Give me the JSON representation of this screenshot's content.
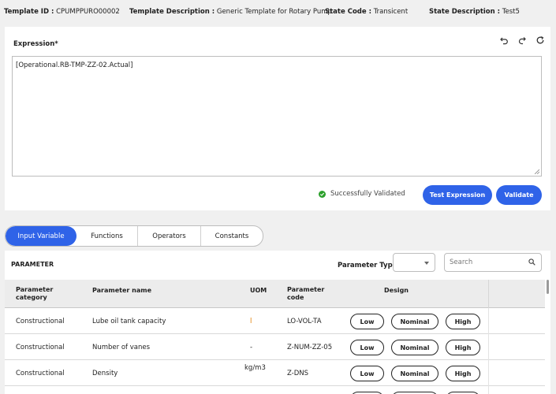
{
  "header": {
    "template_id_label": "Template ID :",
    "template_id": "CPUMPPURO00002",
    "template_desc_label": "Template Description :",
    "template_desc": "Generic Template for Rotary Pump",
    "state_code_label": "State Code :",
    "state_code": "Transicent",
    "state_desc_label": "State Description :",
    "state_desc": "Test5"
  },
  "expression": {
    "title": "Expression*",
    "value": "[Operational.RB-TMP-ZZ-02.Actual]",
    "status": "Successfully Validated",
    "test_button": "Test Expression",
    "validate_button": "Validate",
    "icons": [
      "undo-icon",
      "redo-icon",
      "refresh-icon"
    ]
  },
  "tabs": [
    "Input Variable",
    "Functions",
    "Operators",
    "Constants"
  ],
  "active_tab": "Input Variable",
  "parameters": {
    "title": "PARAMETER",
    "type_label": "Parameter Type",
    "type_value": "",
    "search_placeholder": "Search",
    "columns": {
      "category": "Parameter category",
      "name": "Parameter name",
      "uom": "UOM",
      "code": "Parameter code",
      "design": "Design"
    },
    "rows": [
      {
        "category": "Constructional",
        "name": "Lube oil tank capacity",
        "uom": "l",
        "code": "LO-VOL-TA",
        "low": "Low",
        "nominal": "Nominal",
        "high": "High"
      },
      {
        "category": "Constructional",
        "name": "Number of vanes",
        "uom": "-",
        "code": "Z-NUM-ZZ-05",
        "low": "Low",
        "nominal": "Nominal",
        "high": "High"
      },
      {
        "category": "Constructional",
        "name": "Density",
        "uom": "kg/m3",
        "code": "Z-DNS",
        "low": "Low",
        "nominal": "Nominal",
        "high": "High"
      }
    ]
  },
  "colors": {
    "primary": "#2f63e8",
    "success": "#2ca02c",
    "uom_accent": "#e07b00",
    "page_bg": "#f0f0f0"
  }
}
